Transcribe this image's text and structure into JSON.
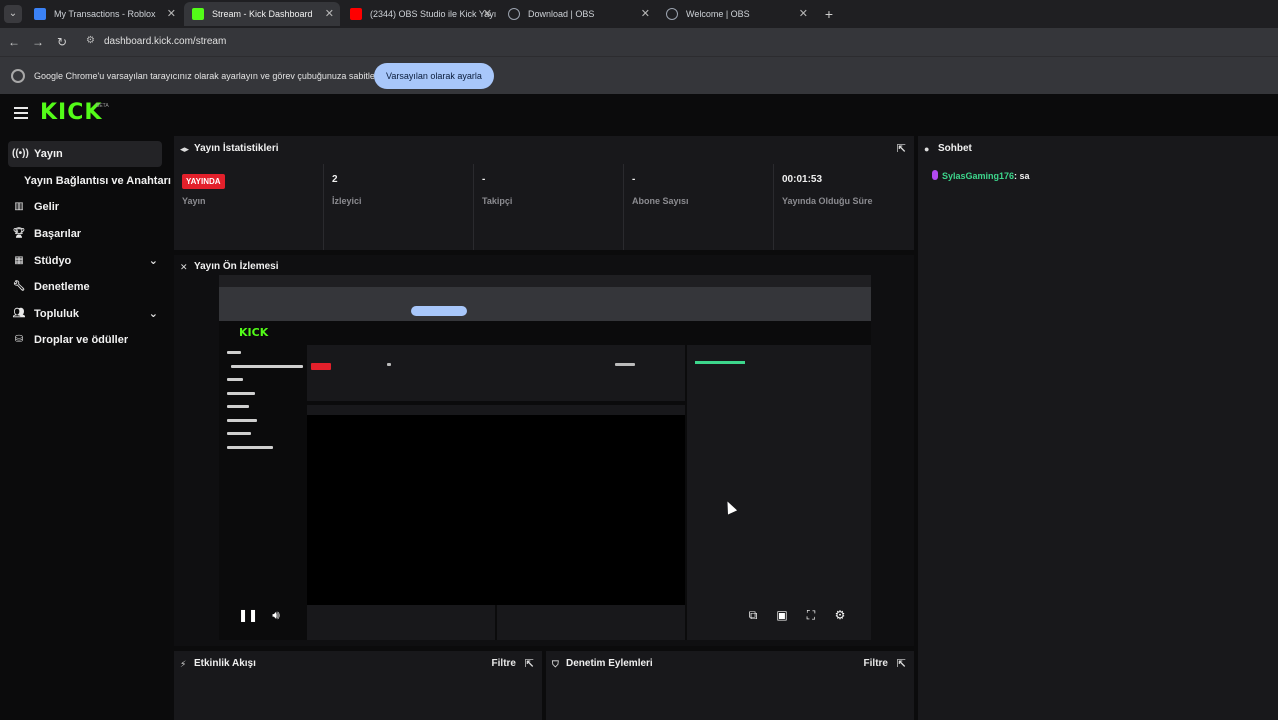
{
  "browser": {
    "tabs": [
      {
        "title": "My Transactions - Roblox",
        "favicon_color": "#3b82f6",
        "active": false
      },
      {
        "title": "Stream - Kick Dashboard",
        "favicon_color": "#53fc18",
        "active": true
      },
      {
        "title": "(2344) OBS Studio ile Kick Yayı",
        "favicon_color": "#ff0000",
        "active": false
      },
      {
        "title": "Download | OBS",
        "favicon_color": "#9ca3af",
        "active": false
      },
      {
        "title": "Welcome | OBS",
        "favicon_color": "#9ca3af",
        "active": false
      }
    ],
    "url": "dashboard.kick.com/stream",
    "infobar_text": "Google Chrome'u varsayılan tarayıcınız olarak ayarlayın ve görev çubuğunuza sabitleyin",
    "infobar_button": "Varsayılan olarak ayarla"
  },
  "header": {
    "logo": "KICK",
    "logo_tag": "BETA"
  },
  "sidebar": {
    "items": [
      {
        "label": "Yayın",
        "icon": "broadcast-icon"
      },
      {
        "label": "Yayın Bağlantısı ve Anahtarı"
      },
      {
        "label": "Gelir",
        "icon": "chart-icon"
      },
      {
        "label": "Başarılar",
        "icon": "trophy-icon"
      },
      {
        "label": "Stüdyo",
        "icon": "studio-icon"
      },
      {
        "label": "Denetleme",
        "icon": "wrench-icon"
      },
      {
        "label": "Topluluk",
        "icon": "community-icon"
      },
      {
        "label": "Droplar ve ödüller",
        "icon": "drops-icon"
      }
    ]
  },
  "stats": {
    "title": "Yayın İstatistikleri",
    "items": [
      {
        "value": "YAYINDA",
        "label": "Yayın"
      },
      {
        "value": "2",
        "label": "İzleyici"
      },
      {
        "value": "-",
        "label": "Takipçi"
      },
      {
        "value": "-",
        "label": "Abone Sayısı"
      },
      {
        "value": "00:01:53",
        "label": "Yayında Olduğu Süre"
      }
    ]
  },
  "preview": {
    "title": "Yayın Ön İzlemesi"
  },
  "activity": {
    "title": "Etkinlik Akışı",
    "filter": "Filtre"
  },
  "moderation": {
    "title": "Denetim Eylemleri",
    "filter": "Filtre"
  },
  "chat": {
    "title": "Sohbet",
    "messages": [
      {
        "user": "SylasGaming176",
        "text": "sa",
        "badge_color": "#b349f1"
      }
    ]
  }
}
